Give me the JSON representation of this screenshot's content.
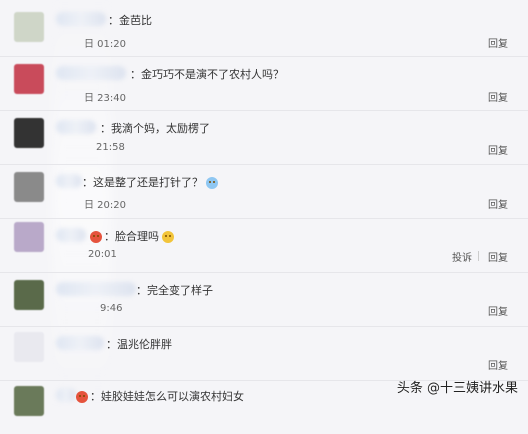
{
  "comments": [
    {
      "text": "：金芭比",
      "time": "日 01:20",
      "actions": [
        "回复"
      ]
    },
    {
      "text": "：金巧巧不是演不了农村人吗？",
      "time": "日 23:40",
      "actions": [
        "回复"
      ]
    },
    {
      "text": "：我滴个妈，太励楞了",
      "time": "21:58",
      "actions": [
        "回复"
      ]
    },
    {
      "text": "：这是整了还是打针了？",
      "time": "日 20:20",
      "actions": [
        "回复"
      ]
    },
    {
      "text": "：脸合理吗",
      "time": "20:01",
      "actions": [
        "投诉",
        "回复"
      ]
    },
    {
      "text": "：完全变了样子",
      "time": "9:46",
      "actions": [
        "回复"
      ]
    },
    {
      "text": "：温兆伦胖胖",
      "time": "",
      "actions": [
        "回复"
      ]
    },
    {
      "text": "：娃胶娃娃怎么可以演农村妇女",
      "time": "",
      "actions": []
    }
  ],
  "watermark": "头条 @十三姨讲水果",
  "colors": {
    "background": "#f5f5f8",
    "text": "#333333",
    "avatars": [
      "#cfd6c8",
      "#c94b5b",
      "#333333",
      "#8a8a8a",
      "#b9a9c9",
      "#5a6a4a",
      "#e9e9ef",
      "#6a7a5a"
    ]
  }
}
